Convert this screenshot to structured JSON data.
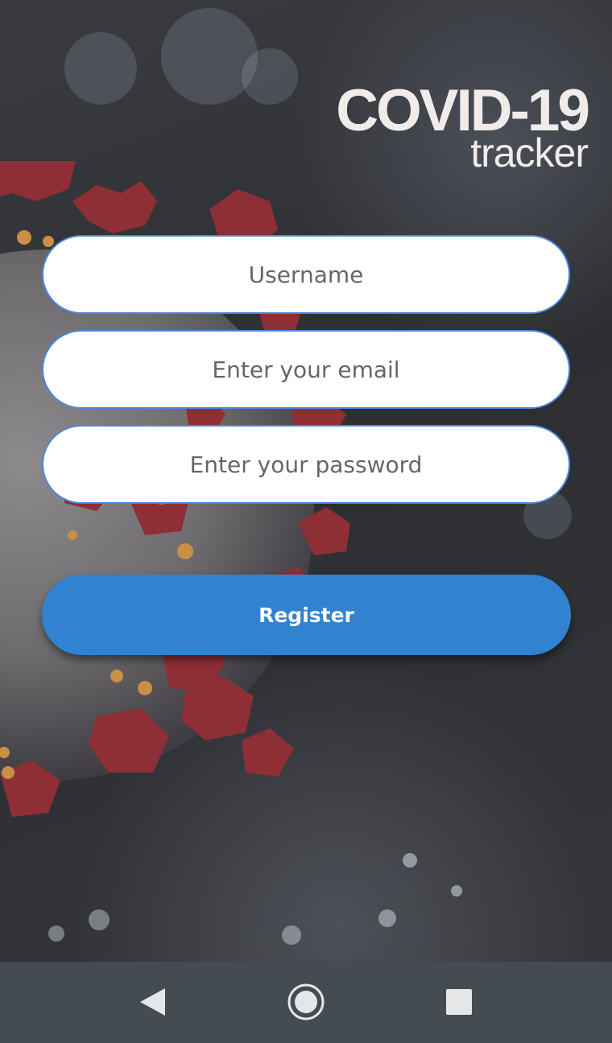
{
  "logo": {
    "title": "COVID-19",
    "subtitle": "tracker"
  },
  "form": {
    "username_placeholder": "Username",
    "username_value": "",
    "email_placeholder": "Enter your email",
    "email_value": "",
    "password_placeholder": "Enter your password",
    "password_value": "",
    "register_label": "Register"
  },
  "navbar": {
    "icons": [
      "back-icon",
      "home-icon",
      "recents-icon"
    ]
  },
  "colors": {
    "accent": "#3182d0",
    "field_border": "#4a86e0",
    "background": "#2f3032",
    "navbar": "#444b51",
    "virus_spike": "#8e2f35"
  }
}
